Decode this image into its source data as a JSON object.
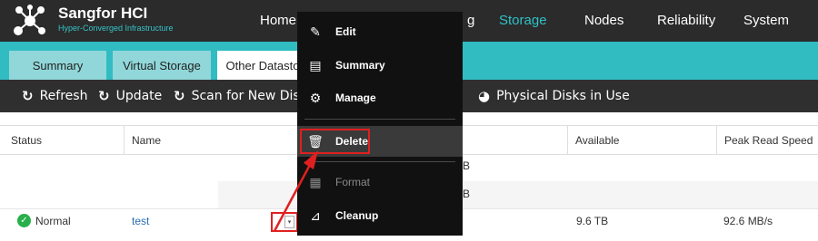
{
  "brand": {
    "name": "Sangfor HCI",
    "subtitle": "Hyper-Converged Infrastructure"
  },
  "nav": [
    "Home",
    "Storage",
    "Nodes",
    "Reliability",
    "System"
  ],
  "nav_partial_visible": "g",
  "active_nav": "Storage",
  "tabs": [
    "Summary",
    "Virtual Storage",
    "Other Datasto"
  ],
  "toolbar": {
    "refresh": "Refresh",
    "update": "Update",
    "scan": "Scan for New Disks",
    "physical_disks": "Physical Disks in Use"
  },
  "table": {
    "headers": {
      "status": "Status",
      "name": "Name",
      "available": "Available",
      "peak_read": "Peak Read Speed"
    },
    "row": {
      "status": "Normal",
      "name": "test",
      "available": "9.6 TB",
      "peak_read": "92.6 MB/s"
    },
    "partial_b1": "B",
    "partial_b2": "B"
  },
  "menu": {
    "edit": "Edit",
    "summary": "Summary",
    "manage": "Manage",
    "delete": "Delete",
    "format": "Format",
    "cleanup": "Cleanup"
  },
  "colors": {
    "accent": "#31bcc2",
    "highlight": "#e02020",
    "header_bg": "#2b2b2b"
  }
}
